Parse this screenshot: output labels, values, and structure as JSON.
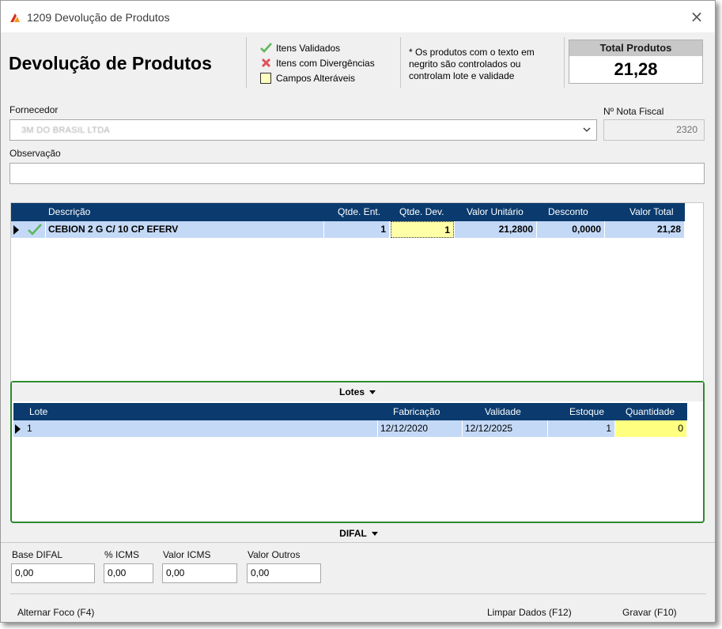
{
  "window": {
    "title": "1209 Devolução de Produtos",
    "close_glyph": "×"
  },
  "header": {
    "title": "Devolução de Produtos",
    "legend": {
      "validated": "Itens Validados",
      "divergent": "Itens com Divergências",
      "editable": "Campos Alteráveis"
    },
    "note_line1": "* Os produtos com o texto em",
    "note_line2": "negrito são controlados ou",
    "note_line3": "controlam lote e validade",
    "total_label": "Total Produtos",
    "total_value": "21,28"
  },
  "form": {
    "fornecedor_label": "Fornecedor",
    "fornecedor_value": "3M DO BRASIL LTDA",
    "nota_fiscal_label": "Nº Nota Fiscal",
    "nota_fiscal_value": "2320",
    "observacao_label": "Observação",
    "observacao_value": ""
  },
  "products": {
    "columns": {
      "descricao": "Descrição",
      "qtde_ent": "Qtde. Ent.",
      "qtde_dev": "Qtde. Dev.",
      "valor_unitario": "Valor Unitário",
      "desconto": "Desconto",
      "valor_total": "Valor Total"
    },
    "rows": [
      {
        "descricao": "CEBION 2 G C/ 10 CP EFERV",
        "qtde_ent": "1",
        "qtde_dev": "1",
        "valor_unitario": "21,2800",
        "desconto": "0,0000",
        "valor_total": "21,28"
      }
    ]
  },
  "lotes": {
    "toggle_label": "Lotes",
    "columns": {
      "lote": "Lote",
      "fabricacao": "Fabricação",
      "validade": "Validade",
      "estoque": "Estoque",
      "quantidade": "Quantidade"
    },
    "rows": [
      {
        "lote": "1",
        "fabricacao": "12/12/2020",
        "validade": "12/12/2025",
        "estoque": "1",
        "quantidade": "0"
      }
    ]
  },
  "difal": {
    "toggle_label": "DIFAL",
    "base_label": "Base DIFAL",
    "base_value": "0,00",
    "icms_pct_label": "% ICMS",
    "icms_pct_value": "0,00",
    "valor_icms_label": "Valor ICMS",
    "valor_icms_value": "0,00",
    "valor_outros_label": "Valor Outros",
    "valor_outros_value": "0,00"
  },
  "footer": {
    "alternar_foco": "Alternar Foco (F4)",
    "limpar_dados": "Limpar Dados (F12)",
    "gravar": "Gravar (F10)"
  },
  "colors": {
    "grid_header": "#0b3b6e",
    "selected_row": "#c4d9f6",
    "editable_cell": "#ffffa8",
    "panel_highlight": "#2d8a2d"
  }
}
